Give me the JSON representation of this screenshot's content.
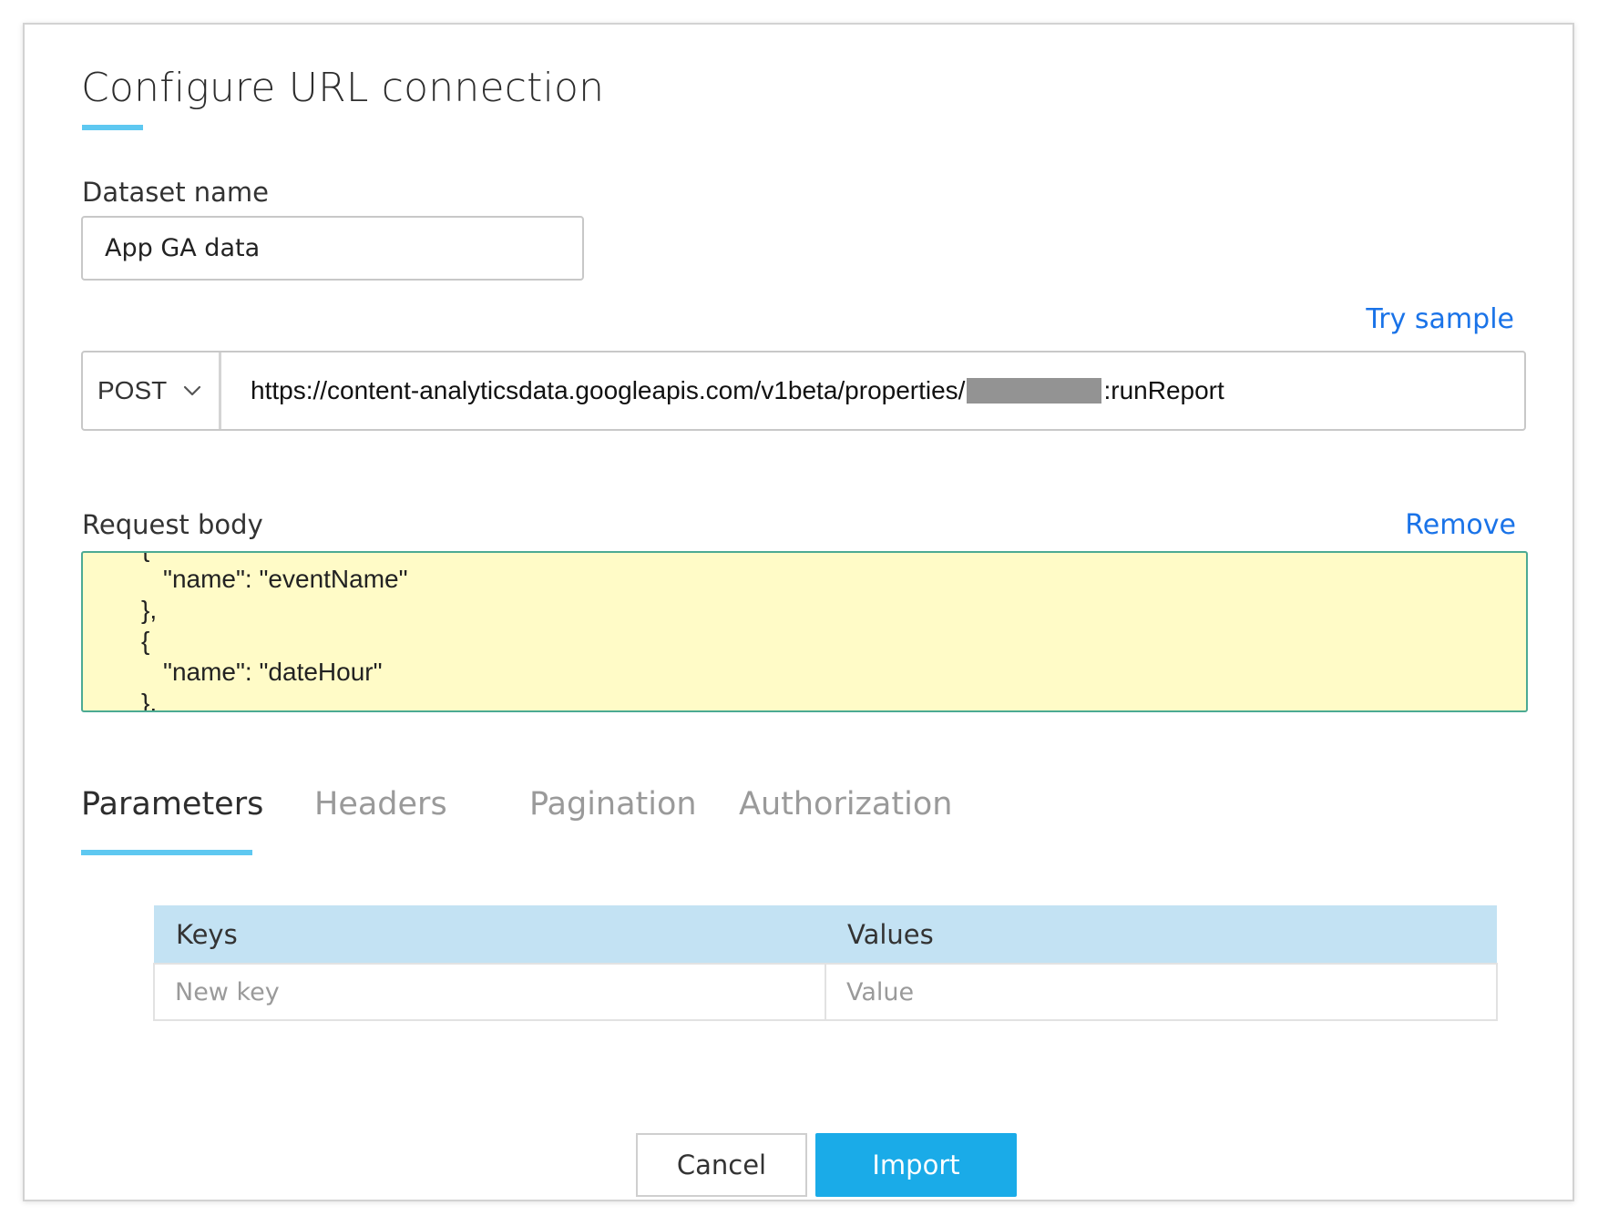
{
  "dialog": {
    "title": "Configure URL connection"
  },
  "dataset": {
    "label": "Dataset name",
    "value": "App GA data"
  },
  "request": {
    "try_sample_label": "Try sample",
    "method": "POST",
    "url_prefix": "https://content-analyticsdata.googleapis.com/v1beta/properties/",
    "url_suffix": ":runReport",
    "body_label": "Request body",
    "remove_label": "Remove",
    "body_lines": [
      "{",
      "\"name\": \"eventName\"",
      "},",
      "{",
      "\"name\": \"dateHour\"",
      "},"
    ]
  },
  "tabs": [
    {
      "label": "Parameters",
      "active": true
    },
    {
      "label": "Headers",
      "active": false
    },
    {
      "label": "Pagination",
      "active": false
    },
    {
      "label": "Authorization",
      "active": false
    }
  ],
  "parameters_table": {
    "columns": [
      "Keys",
      "Values"
    ],
    "new_row": {
      "key_placeholder": "New key",
      "value_placeholder": "Value"
    }
  },
  "footer": {
    "cancel_label": "Cancel",
    "import_label": "Import"
  },
  "colors": {
    "accent": "#5ec8f1",
    "link": "#1a73e8",
    "primary_button": "#1aabe8",
    "request_body_background": "#fffbc7",
    "table_header_background": "#c3e2f3"
  },
  "icons": {
    "method_dropdown": "chevron-down-icon"
  }
}
